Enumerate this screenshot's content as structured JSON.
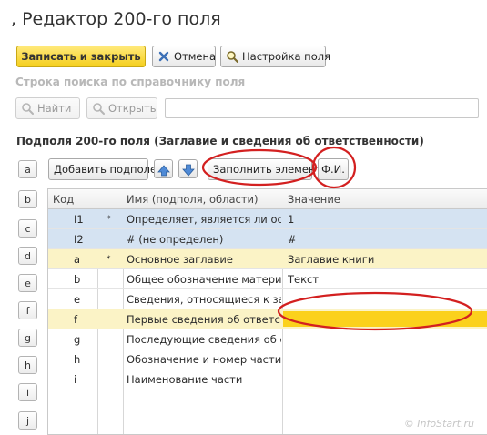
{
  "window": {
    "title": ", Редактор 200-го поля"
  },
  "toolbar": {
    "save_close_label": "Записать и закрыть",
    "cancel_label": "Отмена",
    "settings_label": "Настройка поля"
  },
  "search": {
    "label": "Строка поиска по справочнику поля",
    "find_label": "Найти",
    "open_label": "Открыть",
    "value": ""
  },
  "subfields": {
    "title": "Подполя 200-го поля (Заглавие и сведения об ответственности)",
    "add_label": "Добавить подполе",
    "fill_label": "Заполнить элемент",
    "fio_label": "Ф.И.",
    "side_letters": [
      "a",
      "b",
      "c",
      "d",
      "e",
      "f",
      "g",
      "h",
      "i",
      "j"
    ],
    "columns": {
      "code": "Код",
      "name": "Имя (подполя, области)",
      "value": "Значение"
    },
    "rows": [
      {
        "code": "I1",
        "mark": "*",
        "name": "Определяет, является ли ос...",
        "value": "1",
        "style": "blue"
      },
      {
        "code": "I2",
        "mark": "",
        "name": "# (не определен)",
        "value": "#",
        "style": "blue"
      },
      {
        "code": "a",
        "mark": "*",
        "name": "Основное заглавие",
        "value": "Заглавие книги",
        "style": "yellow"
      },
      {
        "code": "b",
        "mark": "",
        "name": "Общее обозначение матери...",
        "value": "Текст",
        "style": "plain"
      },
      {
        "code": "e",
        "mark": "",
        "name": "Сведения, относящиеся к за...",
        "value": "",
        "style": "plain"
      },
      {
        "code": "f",
        "mark": "",
        "name": "Первые сведения об ответс...",
        "value": "",
        "style": "yellow"
      },
      {
        "code": "g",
        "mark": "",
        "name": "Последующие сведения об о...",
        "value": "",
        "style": "plain"
      },
      {
        "code": "h",
        "mark": "",
        "name": "Обозначение и номер части",
        "value": "",
        "style": "plain"
      },
      {
        "code": "i",
        "mark": "",
        "name": "Наименование части",
        "value": "",
        "style": "plain"
      }
    ]
  },
  "watermark": "© InfoStart.ru",
  "colors": {
    "accent_yellow": "#f5cf1e",
    "selection_blue": "#d5e3f2",
    "highlight_red": "#d32020"
  }
}
